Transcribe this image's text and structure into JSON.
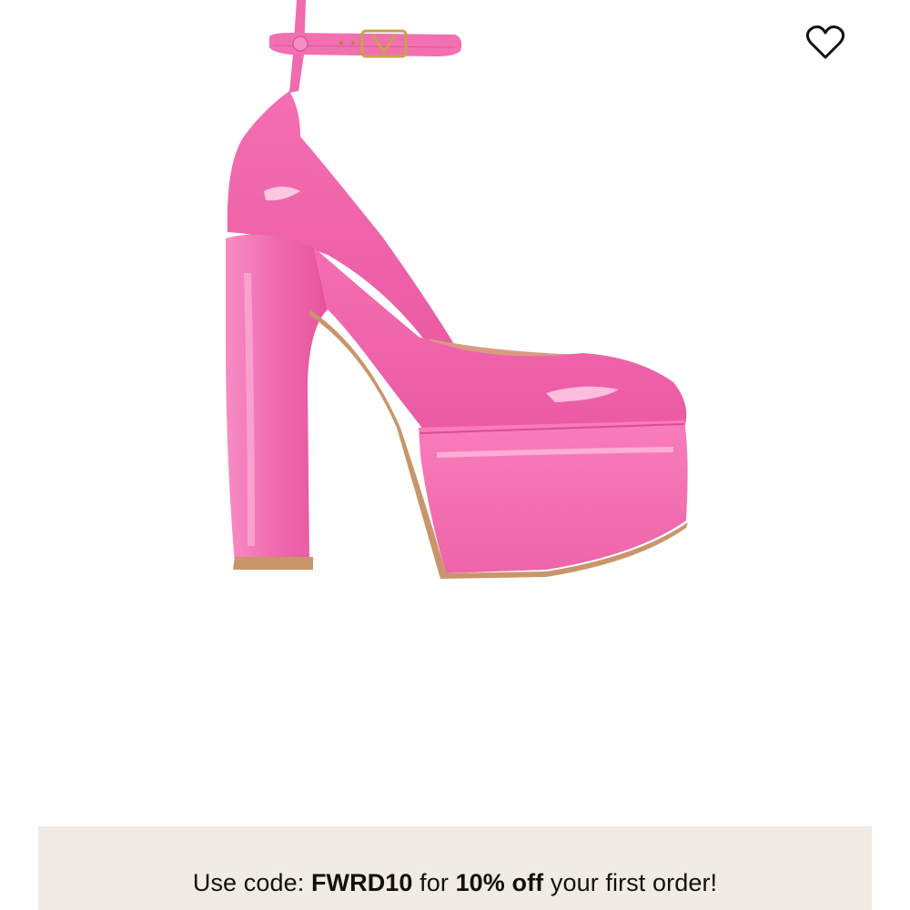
{
  "product": {
    "image_icon": "pink-platform-pump-image",
    "shoe_color": "#f06aae",
    "buckle_logo_text": "V"
  },
  "wishlist": {
    "icon": "heart-outline-icon"
  },
  "promo": {
    "prefix": "Use code: ",
    "code": "FWRD10",
    "middle": " for ",
    "discount": "10% off",
    "suffix": " your first order!",
    "background": "#f0ebe3"
  }
}
